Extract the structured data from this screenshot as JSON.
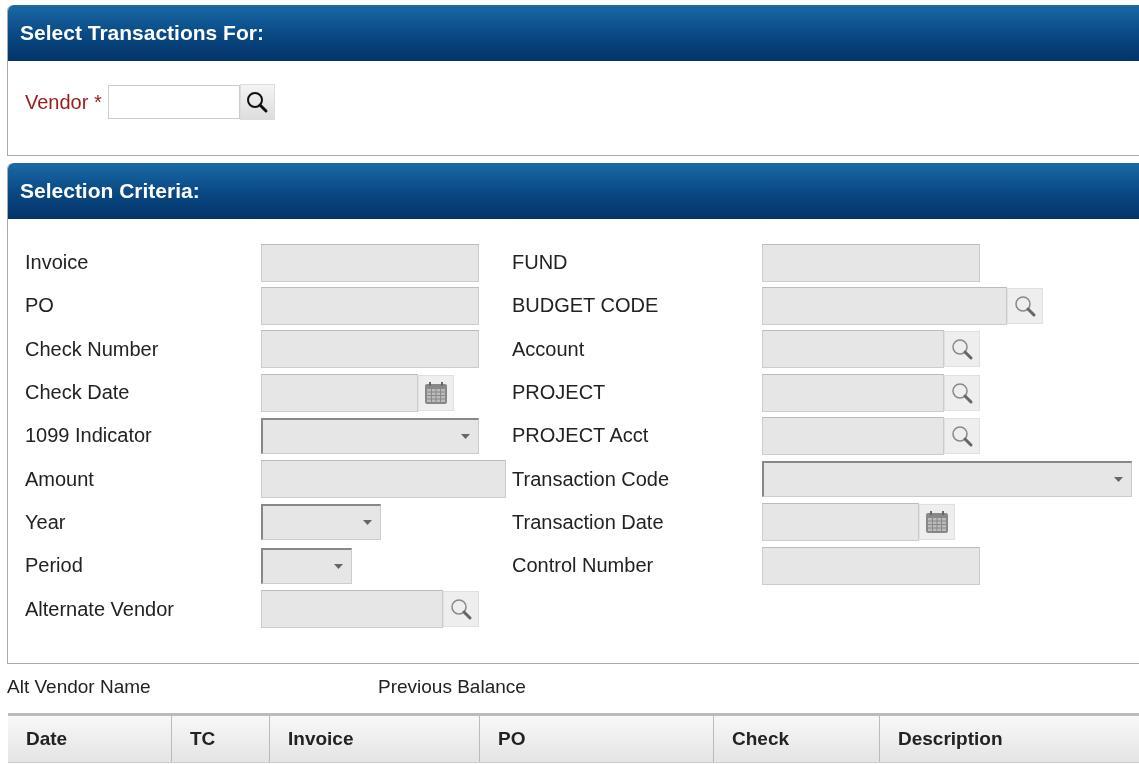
{
  "vendor_panel": {
    "title": "Select Transactions For:",
    "vendor": {
      "label": "Vendor",
      "required_mark": "*"
    }
  },
  "criteria_panel": {
    "title": "Selection Criteria:",
    "left_fields": [
      {
        "label": "Invoice",
        "kind": "text"
      },
      {
        "label": "PO",
        "kind": "text"
      },
      {
        "label": "Check Number",
        "kind": "text"
      },
      {
        "label": "Check Date",
        "kind": "date"
      },
      {
        "label": "1099 Indicator",
        "kind": "select"
      },
      {
        "label": "Amount",
        "kind": "text"
      },
      {
        "label": "Year",
        "kind": "select"
      },
      {
        "label": "Period",
        "kind": "select"
      },
      {
        "label": "Alternate Vendor",
        "kind": "lookup"
      }
    ],
    "right_fields": [
      {
        "label": "FUND",
        "kind": "text"
      },
      {
        "label": "BUDGET CODE",
        "kind": "lookup"
      },
      {
        "label": "Account",
        "kind": "lookup"
      },
      {
        "label": "PROJECT",
        "kind": "lookup"
      },
      {
        "label": "PROJECT Acct",
        "kind": "lookup"
      },
      {
        "label": "Transaction Code",
        "kind": "select"
      },
      {
        "label": "Transaction Date",
        "kind": "date"
      },
      {
        "label": "Control Number",
        "kind": "text"
      }
    ]
  },
  "summary": {
    "alt_vendor_name": "Alt Vendor Name",
    "previous_balance": "Previous Balance"
  },
  "table": {
    "columns": [
      "Date",
      "TC",
      "Invoice",
      "PO",
      "Check",
      "Description"
    ]
  }
}
